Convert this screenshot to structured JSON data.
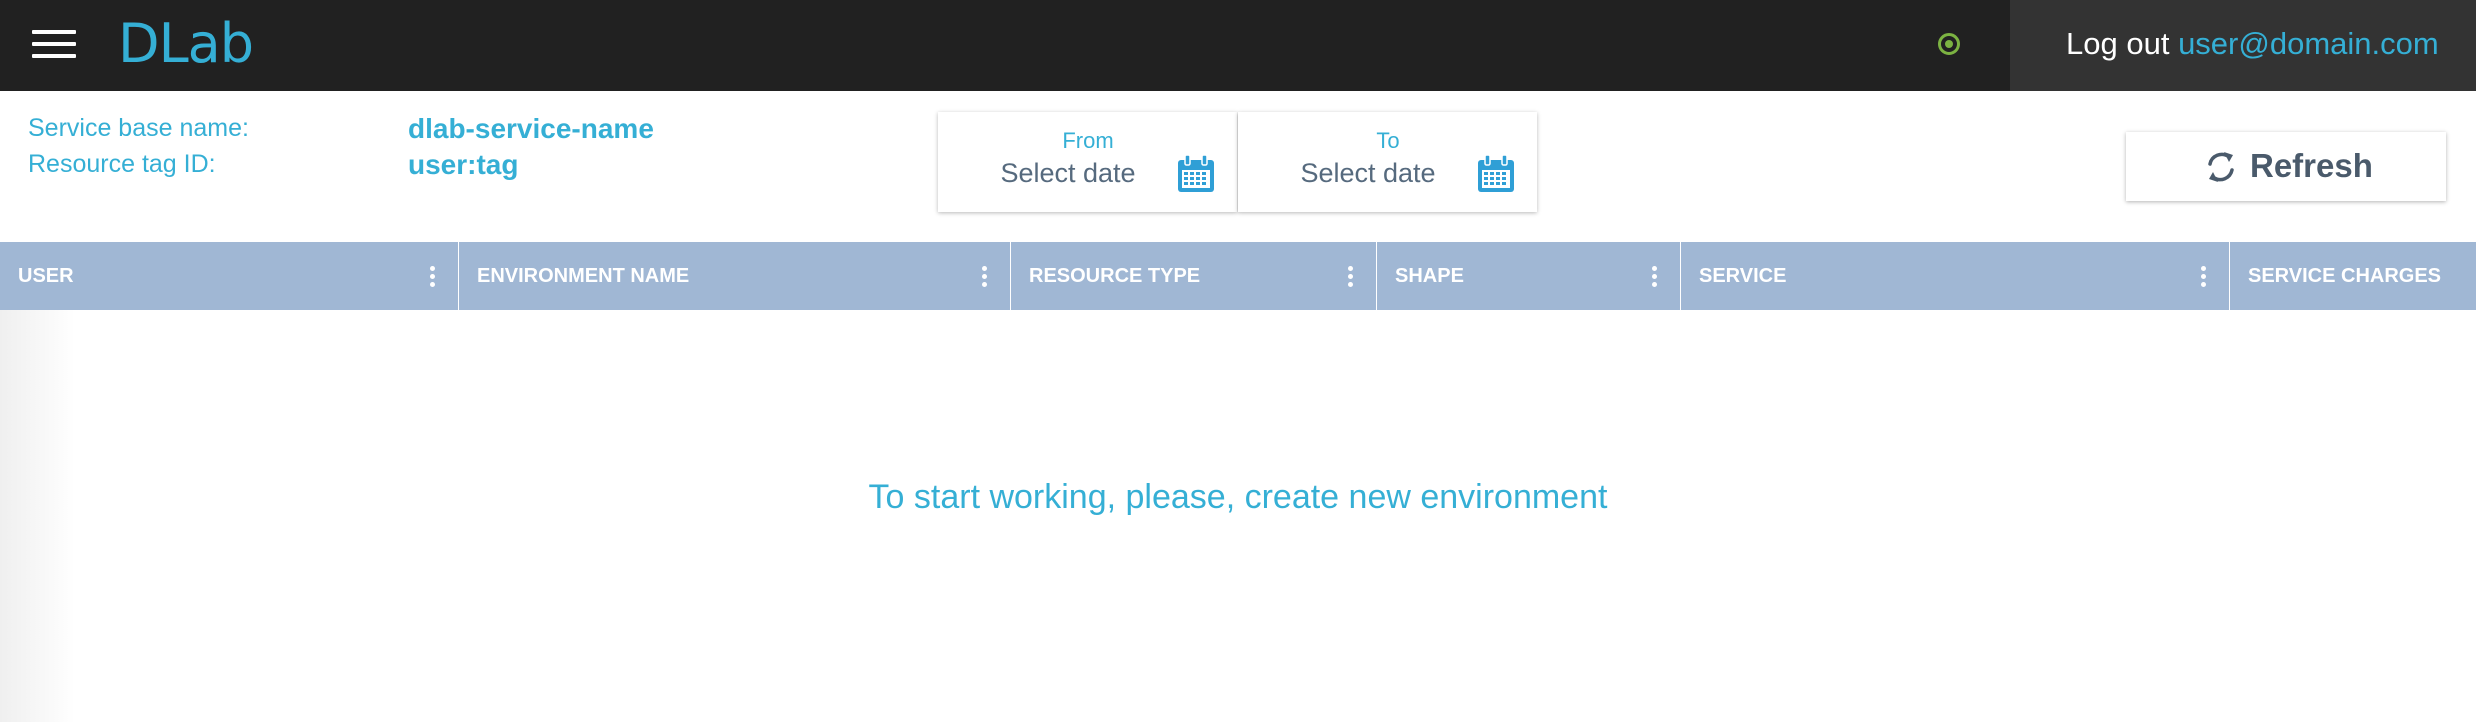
{
  "header": {
    "logo_text": "DLab",
    "logout_label": "Log out",
    "user_email": "user@domain.com",
    "status_color": "#7cb342"
  },
  "info": {
    "service_base_label": "Service base name:",
    "service_base_value": "dlab-service-name",
    "resource_tag_label": "Resource tag ID:",
    "resource_tag_value": "user:tag"
  },
  "date_range": {
    "from": {
      "label": "From",
      "placeholder": "Select date",
      "icon": "calendar-icon"
    },
    "to": {
      "label": "To",
      "placeholder": "Select date",
      "icon": "calendar-icon"
    }
  },
  "toolbar": {
    "refresh_label": "Refresh",
    "refresh_icon": "refresh-icon"
  },
  "grid": {
    "columns": [
      {
        "label": "USER"
      },
      {
        "label": "ENVIRONMENT NAME"
      },
      {
        "label": "RESOURCE TYPE"
      },
      {
        "label": "SHAPE"
      },
      {
        "label": "SERVICE"
      },
      {
        "label": "SERVICE CHARGES"
      }
    ],
    "empty_message": "To start working, please, create new environment"
  },
  "colors": {
    "accent": "#35afd5",
    "topbar": "#212121",
    "header_row": "#a0b7d4"
  }
}
